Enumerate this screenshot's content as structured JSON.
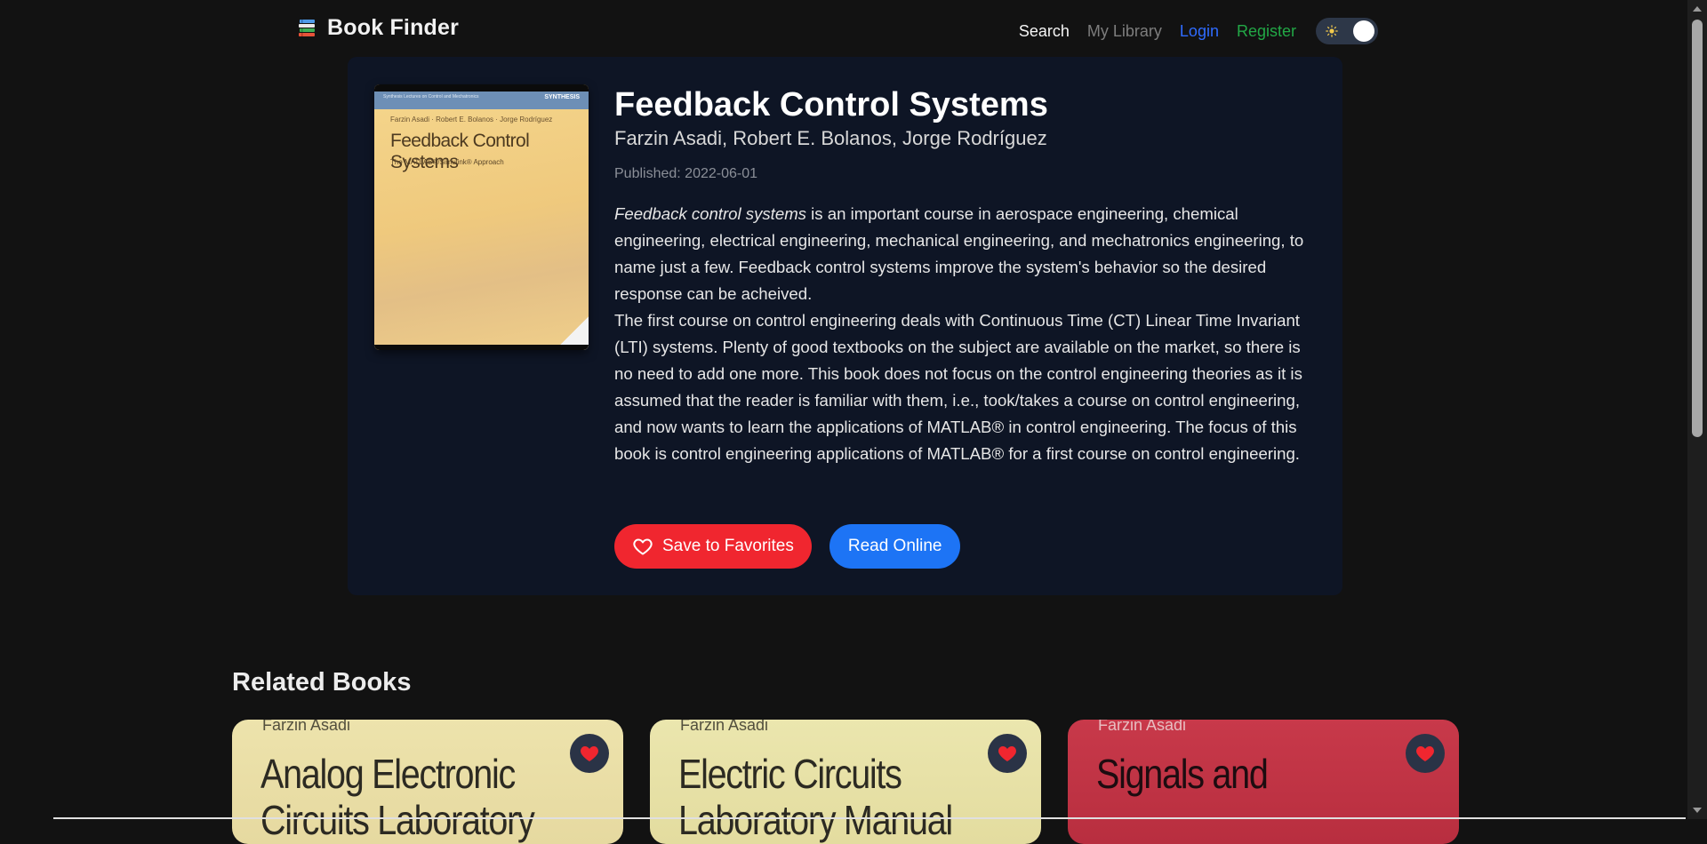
{
  "navbar": {
    "brand": "Book Finder",
    "links": {
      "search": "Search",
      "library": "My Library",
      "login": "Login",
      "register": "Register"
    },
    "theme_toggle": {
      "icon": "sun-icon",
      "state": "dark"
    }
  },
  "book": {
    "title": "Feedback Control Systems",
    "authors": "Farzin Asadi, Robert E. Bolanos, Jorge Rodríguez",
    "published": "Published: 2022-06-01",
    "description_italic": "Feedback control systems",
    "description_p1_rest": " is an important course in aerospace engineering, chemical engineering, electrical engineering, mechanical engineering, and mechatronics engineering, to name just a few. Feedback control systems improve the system's behavior so the desired response can be acheived.",
    "description_p2": "The first course on control engineering deals with Continuous Time (CT) Linear Time Invariant (LTI) systems. Plenty of good textbooks on the subject are available on the market, so there is no need to add one more. This book does not focus on the control engineering theories as it is assumed that the reader is familiar with them, i.e., took/takes a course on control engineering, and now wants to learn the applications of MATLAB® in control engineering. The focus of this book is control engineering applications of MATLAB® for a first course on control engineering.",
    "cover": {
      "series": "Synthesis Lectures on Control and Mechatronics",
      "publisher_mark": "SYNTHESIS",
      "authors": "Farzin Asadi · Robert E. Bolanos · Jorge Rodríguez",
      "title": "Feedback Control Systems",
      "subtitle": "The MATLAB®/Simulink® Approach"
    }
  },
  "actions": {
    "save_label": "Save to Favorites",
    "read_label": "Read Online"
  },
  "related": {
    "heading": "Related Books",
    "items": [
      {
        "author": "Farzin Asadi",
        "title": "Analog Electronic Circuits Laboratory"
      },
      {
        "author": "Farzin Asadi",
        "title": "Electric Circuits Laboratory Manual"
      },
      {
        "author": "Farzin Asadi",
        "title": "Signals and"
      }
    ]
  },
  "colors": {
    "background": "#121212",
    "card": "#0e1525",
    "favorite": "#f0262f",
    "read": "#1d74f5",
    "login": "#2f6bff",
    "register": "#22a846"
  }
}
